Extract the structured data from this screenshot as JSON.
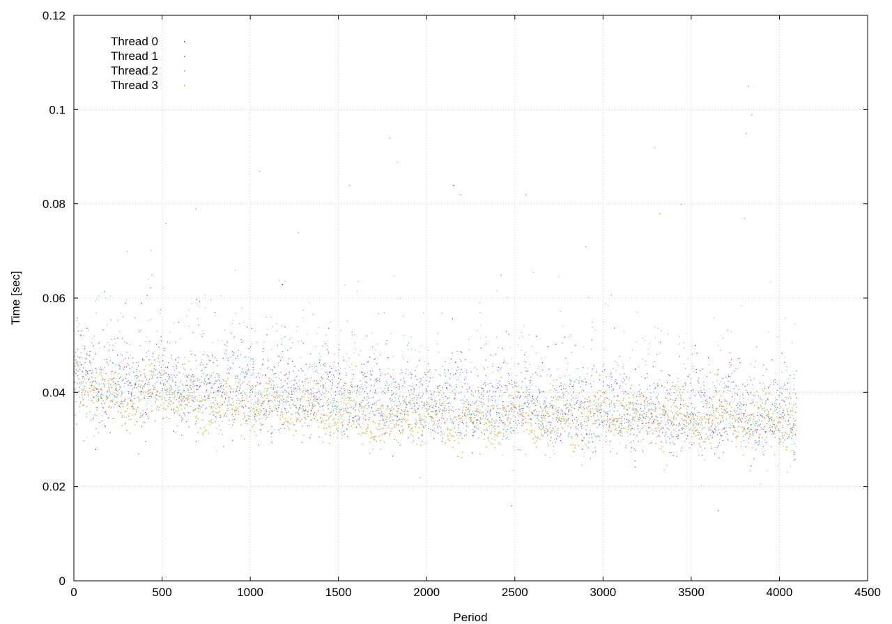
{
  "chart_data": {
    "type": "scatter",
    "title": "",
    "xlabel": "Period",
    "ylabel": "Time [sec]",
    "xlim": [
      0,
      4500
    ],
    "ylim": [
      0,
      0.12
    ],
    "x_ticks": [
      "0",
      "500",
      "1000",
      "1500",
      "2000",
      "2500",
      "3000",
      "3500",
      "4000",
      "4500"
    ],
    "y_ticks": [
      "0",
      "0.02",
      "0.04",
      "0.06",
      "0.08",
      "0.1",
      "0.12"
    ],
    "grid": true,
    "legend_position": "top-left",
    "x_range_of_data": [
      0,
      4095
    ],
    "series": [
      {
        "name": "Thread 0",
        "color": "#9400d3",
        "trend_x": [
          0,
          250,
          500,
          750,
          1000,
          1250,
          1500,
          1750,
          2000,
          2250,
          2500,
          2750,
          3000,
          3250,
          3500,
          3750,
          4095
        ],
        "trend_y": [
          0.0425,
          0.0415,
          0.041,
          0.0405,
          0.0398,
          0.0392,
          0.0387,
          0.0378,
          0.0372,
          0.037,
          0.0368,
          0.0362,
          0.0358,
          0.0356,
          0.0352,
          0.035,
          0.0348
        ],
        "outliers": [
          [
            120,
            0.028
          ],
          [
            1180,
            0.063
          ],
          [
            1450,
            0.031
          ],
          [
            2150,
            0.084
          ],
          [
            2620,
            0.052
          ],
          [
            3180,
            0.045
          ],
          [
            3520,
            0.05
          ]
        ]
      },
      {
        "name": "Thread 1",
        "color": "#009e73",
        "trend_x": [
          0,
          250,
          500,
          750,
          1000,
          1250,
          1500,
          1750,
          2000,
          2250,
          2500,
          2750,
          3000,
          3250,
          3500,
          3750,
          4095
        ],
        "trend_y": [
          0.042,
          0.0412,
          0.0408,
          0.04,
          0.0396,
          0.039,
          0.0384,
          0.0376,
          0.037,
          0.0368,
          0.0366,
          0.036,
          0.0357,
          0.0355,
          0.0351,
          0.0349,
          0.0347
        ],
        "outliers": [
          [
            380,
            0.059
          ],
          [
            900,
            0.048
          ],
          [
            1700,
            0.03
          ],
          [
            2480,
            0.016
          ],
          [
            2880,
            0.028
          ],
          [
            3650,
            0.015
          ]
        ]
      },
      {
        "name": "Thread 2",
        "color": "#56b4e9",
        "trend_x": [
          0,
          250,
          500,
          750,
          1000,
          1250,
          1500,
          1750,
          2000,
          2250,
          2500,
          2750,
          3000,
          3250,
          3500,
          3750,
          4095
        ],
        "trend_y": [
          0.0435,
          0.0428,
          0.0425,
          0.042,
          0.0412,
          0.0405,
          0.0398,
          0.0392,
          0.0385,
          0.038,
          0.0378,
          0.0372,
          0.0368,
          0.0365,
          0.0362,
          0.036,
          0.0358
        ],
        "outliers": [
          [
            300,
            0.07
          ],
          [
            520,
            0.076
          ],
          [
            690,
            0.079
          ],
          [
            1050,
            0.087
          ],
          [
            1270,
            0.074
          ],
          [
            1560,
            0.084
          ],
          [
            1790,
            0.094
          ],
          [
            1830,
            0.089
          ],
          [
            2190,
            0.082
          ],
          [
            2420,
            0.065
          ],
          [
            2560,
            0.082
          ],
          [
            2900,
            0.071
          ],
          [
            3290,
            0.092
          ],
          [
            3440,
            0.08
          ],
          [
            3820,
            0.105
          ],
          [
            3840,
            0.099
          ],
          [
            3810,
            0.095
          ],
          [
            4000,
            0.03
          ]
        ]
      },
      {
        "name": "Thread 3",
        "color": "#e69f00",
        "trend_x": [
          0,
          250,
          500,
          750,
          1000,
          1250,
          1500,
          1750,
          2000,
          2250,
          2500,
          2750,
          3000,
          3250,
          3500,
          3750,
          4095
        ],
        "trend_y": [
          0.042,
          0.039,
          0.04,
          0.037,
          0.038,
          0.037,
          0.036,
          0.033,
          0.035,
          0.034,
          0.035,
          0.034,
          0.035,
          0.035,
          0.034,
          0.034,
          0.034
        ],
        "outliers": [
          [
            440,
            0.065
          ],
          [
            1960,
            0.022
          ],
          [
            3320,
            0.078
          ],
          [
            3800,
            0.077
          ],
          [
            2300,
            0.027
          ]
        ]
      }
    ]
  }
}
